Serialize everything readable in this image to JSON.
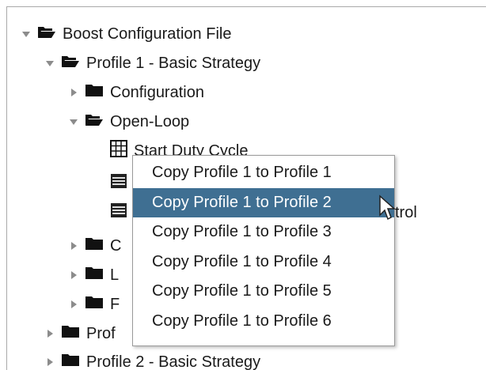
{
  "tree": {
    "nodes": [
      {
        "label": "Boost Configuration File",
        "expanded": true,
        "icon": "folder-open-icon"
      },
      {
        "label": "Profile 1 - Basic Strategy",
        "expanded": true,
        "icon": "folder-open-icon"
      },
      {
        "label": "Configuration",
        "expanded": false,
        "icon": "folder-closed-icon"
      },
      {
        "label": "Open-Loop",
        "expanded": true,
        "icon": "folder-open-icon"
      },
      {
        "label": "Start Duty Cycle",
        "icon": "table-grid-icon"
      },
      {
        "label": "",
        "icon": "list-table-icon"
      },
      {
        "label": "trol",
        "icon": "list-table-icon"
      },
      {
        "label": "C",
        "expanded": false,
        "icon": "folder-closed-icon"
      },
      {
        "label": "L",
        "expanded": false,
        "icon": "folder-closed-icon"
      },
      {
        "label": "F",
        "expanded": false,
        "icon": "folder-closed-icon"
      },
      {
        "label": "Prof",
        "expanded": false,
        "icon": "folder-closed-icon"
      },
      {
        "label": "Profile 2 - Basic Strategy",
        "expanded": false,
        "icon": "folder-closed-icon"
      }
    ]
  },
  "context_menu": {
    "items": [
      "Copy Profile 1 to Profile 1",
      "Copy Profile 1 to Profile 2",
      "Copy Profile 1 to Profile 3",
      "Copy Profile 1 to Profile 4",
      "Copy Profile 1 to Profile 5",
      "Copy Profile 1 to Profile 6"
    ],
    "selected_index": 1
  },
  "colors": {
    "selection": "#3f6f92",
    "tree_arrow": "#8c8c8c",
    "folder": "#111111"
  }
}
